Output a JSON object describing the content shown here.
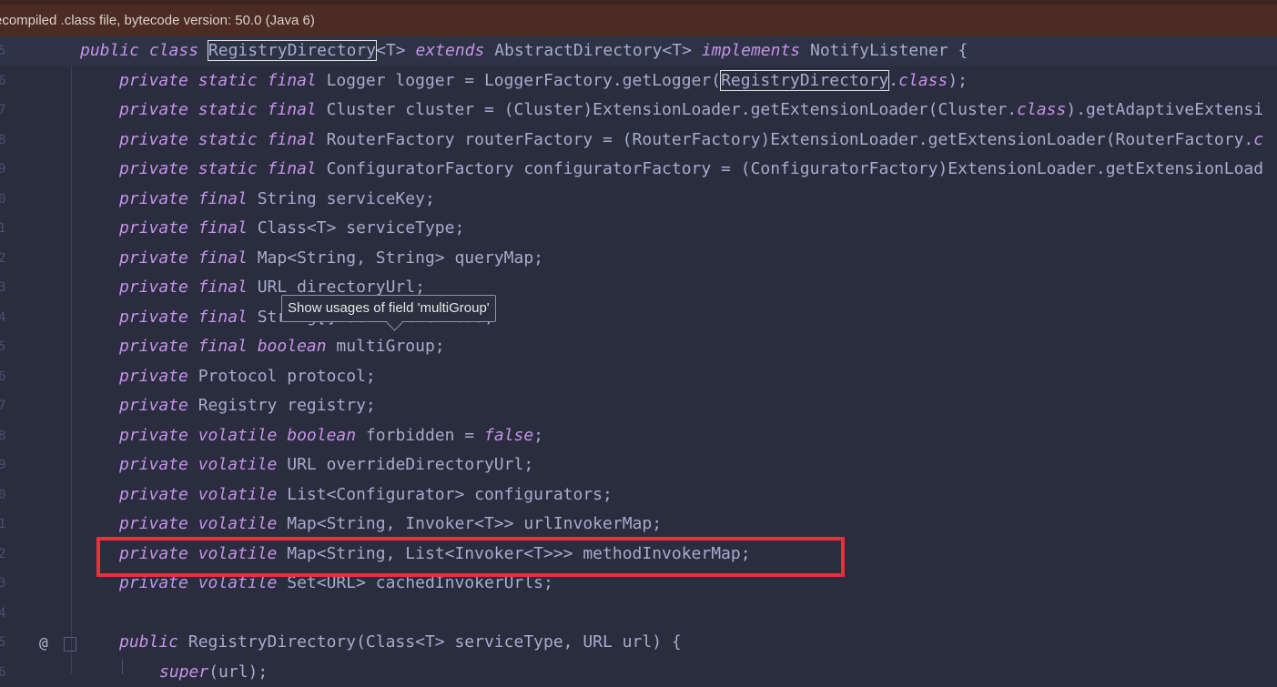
{
  "banner": {
    "text": "ecompiled .class file, bytecode version: 50.0 (Java 6)"
  },
  "tooltip": {
    "text": "Show usages of field 'multiGroup'"
  },
  "gutter": {
    "annotation_icon": "@",
    "fold_icon": "fold-icon"
  },
  "colors": {
    "background": "#292d3e",
    "keyword": "#c792ea",
    "highlight_box": "#e8303a"
  },
  "lines": [
    {
      "num": "5",
      "indent": 0,
      "tokens": [
        [
          "kw",
          "public class "
        ],
        [
          "boxed",
          "RegistryDirectory"
        ],
        [
          "pl",
          "<T> "
        ],
        [
          "kw",
          "extends "
        ],
        [
          "pl",
          "AbstractDirectory<T> "
        ],
        [
          "kw",
          "implements "
        ],
        [
          "pl",
          "NotifyListener {"
        ]
      ]
    },
    {
      "num": "6",
      "indent": 1,
      "tokens": [
        [
          "kw",
          "private static final "
        ],
        [
          "pl",
          "Logger logger = LoggerFactory.getLogger("
        ],
        [
          "boxed",
          "RegistryDirectory"
        ],
        [
          "pl",
          "."
        ],
        [
          "kw",
          "class"
        ],
        [
          "pl",
          ");"
        ]
      ]
    },
    {
      "num": "7",
      "indent": 1,
      "tokens": [
        [
          "kw",
          "private static final "
        ],
        [
          "pl",
          "Cluster cluster = (Cluster)ExtensionLoader.getExtensionLoader(Cluster."
        ],
        [
          "kw",
          "class"
        ],
        [
          "pl",
          ").getAdaptiveExtensi"
        ]
      ]
    },
    {
      "num": "8",
      "indent": 1,
      "tokens": [
        [
          "kw",
          "private static final "
        ],
        [
          "pl",
          "RouterFactory routerFactory = (RouterFactory)ExtensionLoader.getExtensionLoader(RouterFactory."
        ],
        [
          "kw",
          "c"
        ]
      ]
    },
    {
      "num": "9",
      "indent": 1,
      "tokens": [
        [
          "kw",
          "private static final "
        ],
        [
          "pl",
          "ConfiguratorFactory configuratorFactory = (ConfiguratorFactory)ExtensionLoader.getExtensionLoad"
        ]
      ]
    },
    {
      "num": "0",
      "indent": 1,
      "tokens": [
        [
          "kw",
          "private final "
        ],
        [
          "pl",
          "String serviceKey;"
        ]
      ]
    },
    {
      "num": "1",
      "indent": 1,
      "tokens": [
        [
          "kw",
          "private final "
        ],
        [
          "pl",
          "Class<T> serviceType;"
        ]
      ]
    },
    {
      "num": "2",
      "indent": 1,
      "tokens": [
        [
          "kw",
          "private final "
        ],
        [
          "pl",
          "Map<String, String> queryMap;"
        ]
      ]
    },
    {
      "num": "3",
      "indent": 1,
      "tokens": [
        [
          "kw",
          "private final "
        ],
        [
          "pl",
          "URL directoryUrl;"
        ]
      ]
    },
    {
      "num": "4",
      "indent": 1,
      "tokens": [
        [
          "kw",
          "private final "
        ],
        [
          "pl",
          "String[] serviceMethods;"
        ]
      ]
    },
    {
      "num": "5",
      "indent": 1,
      "tokens": [
        [
          "kw",
          "private final boolean "
        ],
        [
          "pl",
          "multiGroup;"
        ]
      ]
    },
    {
      "num": "6",
      "indent": 1,
      "tokens": [
        [
          "kw",
          "private "
        ],
        [
          "pl",
          "Protocol protocol;"
        ]
      ]
    },
    {
      "num": "7",
      "indent": 1,
      "tokens": [
        [
          "kw",
          "private "
        ],
        [
          "pl",
          "Registry registry;"
        ]
      ]
    },
    {
      "num": "8",
      "indent": 1,
      "tokens": [
        [
          "kw",
          "private volatile boolean "
        ],
        [
          "pl",
          "forbidden = "
        ],
        [
          "kw",
          "false"
        ],
        [
          "pl",
          ";"
        ]
      ]
    },
    {
      "num": "9",
      "indent": 1,
      "tokens": [
        [
          "kw",
          "private volatile "
        ],
        [
          "pl",
          "URL overrideDirectoryUrl;"
        ]
      ]
    },
    {
      "num": "0",
      "indent": 1,
      "tokens": [
        [
          "kw",
          "private volatile "
        ],
        [
          "pl",
          "List<Configurator> configurators;"
        ]
      ]
    },
    {
      "num": "1",
      "indent": 1,
      "tokens": [
        [
          "kw",
          "private volatile "
        ],
        [
          "pl",
          "Map<String, Invoker<T>> urlInvokerMap;"
        ]
      ]
    },
    {
      "num": "2",
      "indent": 1,
      "tokens": [
        [
          "kw",
          "private volatile "
        ],
        [
          "pl",
          "Map<String, List<Invoker<T>>> methodInvokerMap;"
        ]
      ]
    },
    {
      "num": "3",
      "indent": 1,
      "tokens": [
        [
          "kw",
          "private volatile "
        ],
        [
          "pl",
          "Set<URL> cachedInvokerUrls;"
        ]
      ]
    },
    {
      "num": "4",
      "indent": 1,
      "tokens": []
    },
    {
      "num": "5",
      "indent": 1,
      "tokens": [
        [
          "kw",
          "public "
        ],
        [
          "pl",
          "RegistryDirectory(Class<T> serviceType, URL url) {"
        ]
      ]
    },
    {
      "num": "6",
      "indent": 2,
      "tokens": [
        [
          "kw",
          "super"
        ],
        [
          "pl",
          "(url);"
        ]
      ]
    }
  ]
}
